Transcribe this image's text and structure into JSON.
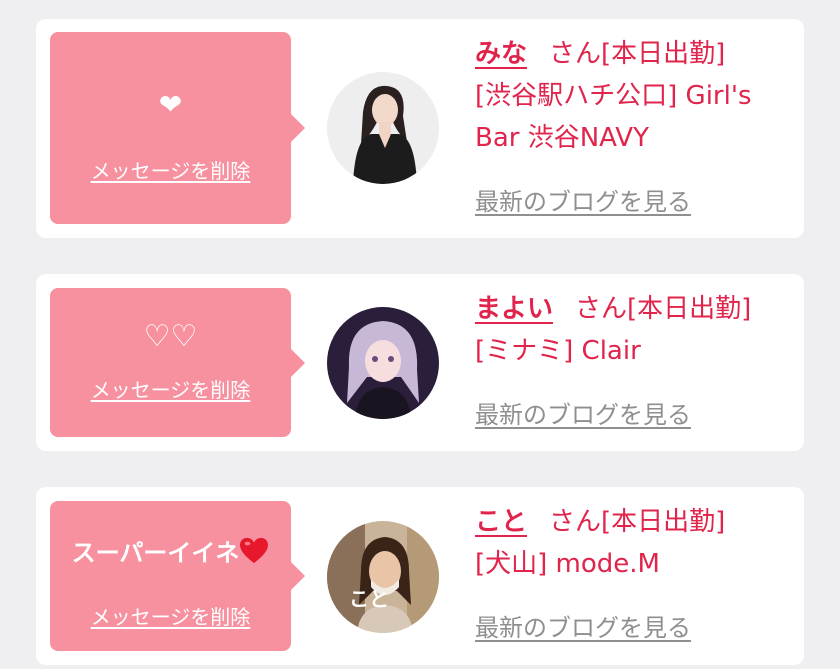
{
  "cards": [
    {
      "message": "❤",
      "delete_label": "メッセージを削除",
      "name": "みな",
      "honorific": "さん",
      "status": "[本日出勤]",
      "shop_line1": "[渋谷駅ハチ公口] Girl's",
      "shop_line2": "Bar 渋谷NAVY",
      "blog_label": "最新のブログを見る"
    },
    {
      "message": "♡♡",
      "delete_label": "メッセージを削除",
      "name": "まよい",
      "honorific": "さん",
      "status": "[本日出勤]",
      "shop_line1": "[ミナミ] Clair",
      "blog_label": "最新のブログを見る"
    },
    {
      "message": "スーパーイイネ",
      "message_icon": "red-heart-icon",
      "delete_label": "メッセージを削除",
      "name": "こと",
      "honorific": "さん",
      "status": "[本日出勤]",
      "shop_line1": "[犬山] mode.M",
      "avatar_caption": "こと",
      "blog_label": "最新のブログを見る"
    }
  ],
  "colors": {
    "accent": "#e0244c",
    "bubble": "#f7919f",
    "link_gray": "#8f8f8f",
    "background": "#efeff1"
  }
}
